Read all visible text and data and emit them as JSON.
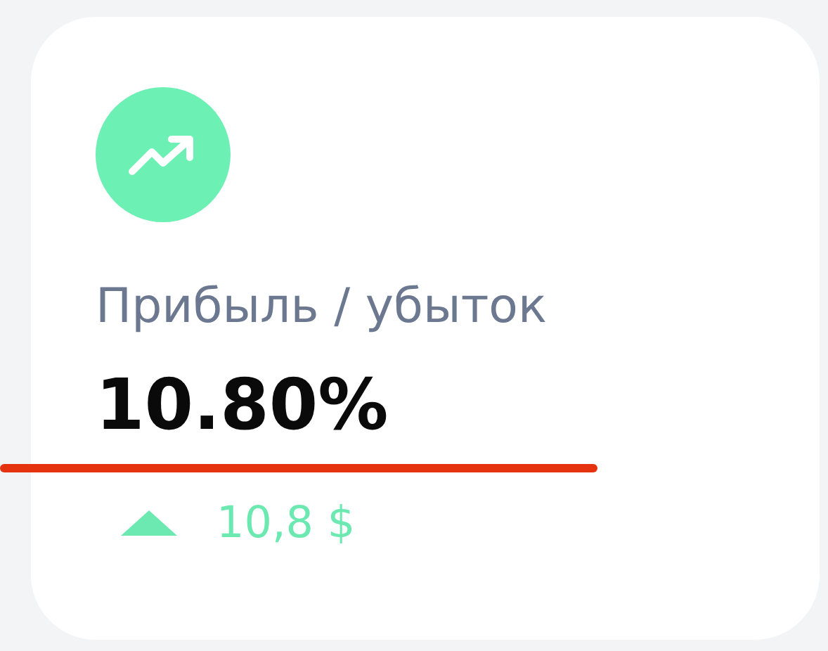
{
  "card": {
    "label": "Прибыль / убыток",
    "value": "10.80%",
    "change": {
      "rising": true,
      "text": "10,8 $"
    },
    "annotation": {
      "kind": "underline",
      "color": "#e5330f"
    }
  }
}
